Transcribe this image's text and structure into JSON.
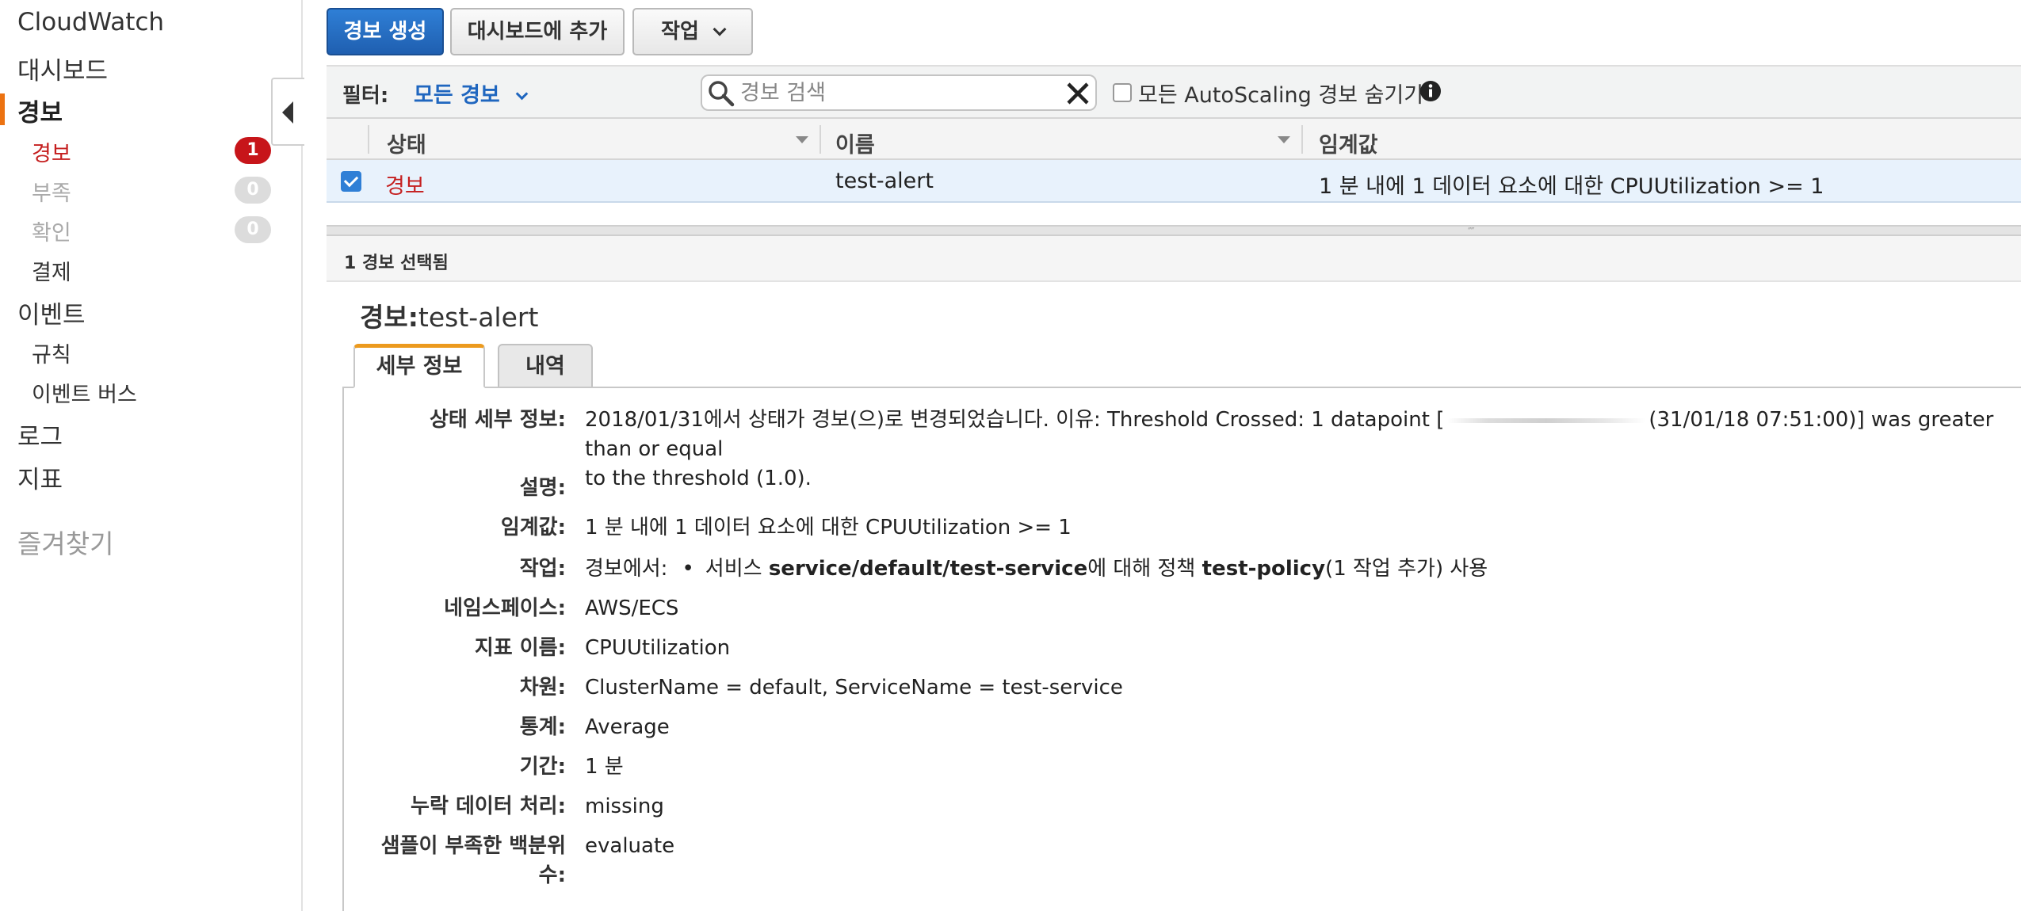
{
  "sidebar": {
    "title": "CloudWatch",
    "dashboard": "대시보드",
    "alarms": "경보",
    "sub_alarm": {
      "label": "경보",
      "count": "1"
    },
    "sub_insufficient": {
      "label": "부족",
      "count": "0"
    },
    "sub_ok": {
      "label": "확인",
      "count": "0"
    },
    "billing": "결제",
    "events": "이벤트",
    "rules": "규칙",
    "event_bus": "이벤트 버스",
    "logs": "로그",
    "metrics": "지표",
    "favorites": "즐겨찾기"
  },
  "toolbar": {
    "create_alarm": "경보 생성",
    "add_dashboard": "대시보드에 추가",
    "actions": "작업"
  },
  "filter": {
    "label": "필터:",
    "value": "모든 경보",
    "search_placeholder": "경보 검색",
    "hide_autoscaling": "모든 AutoScaling 경보 숨기기"
  },
  "table": {
    "columns": [
      "상태",
      "이름",
      "임계값"
    ],
    "rows": [
      {
        "state": "경보",
        "name": "test-alert",
        "threshold": "1 분 내에 1 데이터 요소에 대한 CPUUtilization >= 1"
      }
    ]
  },
  "detail": {
    "selected_text": "1 경보 선택됨",
    "title_prefix": "경보:",
    "title_name": "test-alert",
    "tabs": [
      "세부 정보",
      "내역"
    ],
    "fields": {
      "state_details_label": "상태 세부 정보:",
      "state_details_a": "2018/01/31에서 상태가 경보(으)로 변경되었습니다. 이유: Threshold Crossed: 1 datapoint [",
      "state_details_b": "(31/01/18 07:51:00)] was greater than or equal",
      "state_details_c": "to the threshold (1.0).",
      "description_label": "설명:",
      "threshold_label": "임계값:",
      "threshold_value": "1 분 내에 1 데이터 요소에 대한 CPUUtilization >= 1",
      "actions_label": "작업:",
      "actions_prefix": "경보에서:",
      "actions_service_prefix": "서비스 ",
      "actions_service": "service/default/test-service",
      "actions_mid": "에 대해 정책 ",
      "actions_policy": "test-policy",
      "actions_suffix": "(1 작업 추가) 사용",
      "namespace_label": "네임스페이스:",
      "namespace_value": "AWS/ECS",
      "metric_label": "지표 이름:",
      "metric_value": "CPUUtilization",
      "dimensions_label": "차원:",
      "dimensions_value": "ClusterName = default, ServiceName = test-service",
      "statistic_label": "통계:",
      "statistic_value": "Average",
      "period_label": "기간:",
      "period_value": "1 분",
      "missing_label": "누락 데이터 처리:",
      "missing_value": "missing",
      "percentile_label_1": "샘플이 부족한 백분위",
      "percentile_label_2": "수:",
      "percentile_value": "evaluate"
    }
  },
  "colors": {
    "primary": "#2f7fd6",
    "alarm_red": "#c51f1f",
    "accent_orange": "#ec7211",
    "link_blue": "#1f66bf"
  }
}
